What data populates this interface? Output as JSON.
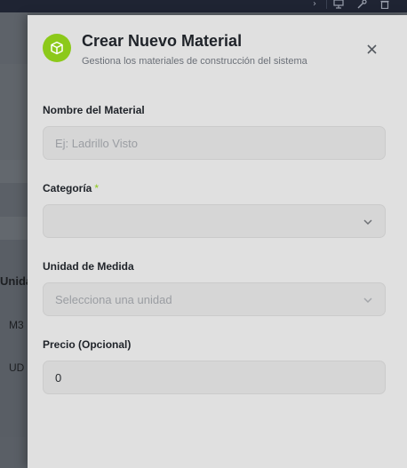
{
  "background": {
    "column_header": "Unida",
    "rows": [
      "M3",
      "UD"
    ]
  },
  "modal": {
    "title": "Crear Nuevo Material",
    "subtitle": "Gestiona los materiales de construcción del sistema",
    "icon": "box-icon",
    "accent_color": "#8cc91a",
    "close_icon": "close-icon"
  },
  "form": {
    "name": {
      "label": "Nombre del Material",
      "placeholder": "Ej: Ladrillo Visto",
      "value": ""
    },
    "category": {
      "label": "Categoría",
      "required_mark": "*",
      "value": ""
    },
    "unit": {
      "label": "Unidad de Medida",
      "placeholder": "Selecciona una unidad"
    },
    "price": {
      "label": "Precio (Opcional)",
      "value": "0"
    }
  }
}
